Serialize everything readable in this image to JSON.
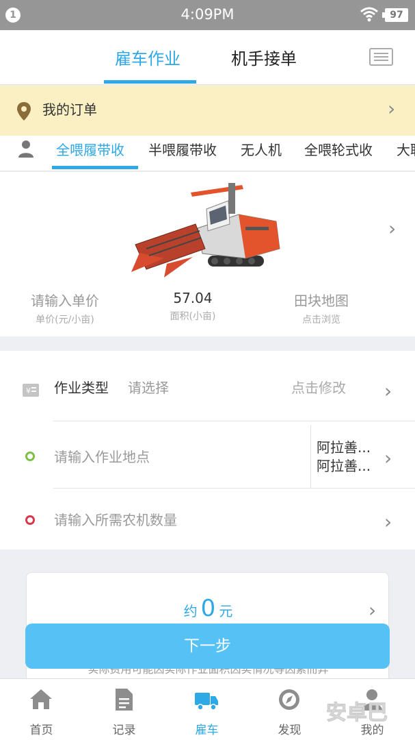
{
  "status_bar": {
    "notification_count": "1",
    "time": "4:09PM",
    "battery": "97"
  },
  "top_tabs": [
    {
      "label": "雇车作业",
      "active": true
    },
    {
      "label": "机手接单",
      "active": false
    }
  ],
  "order_banner": {
    "label": "我的订单"
  },
  "category_tabs": [
    {
      "label": "全喂履带收",
      "active": true
    },
    {
      "label": "半喂履带收",
      "active": false
    },
    {
      "label": "无人机",
      "active": false
    },
    {
      "label": "全喂轮式收",
      "active": false
    },
    {
      "label": "大联",
      "active": false
    }
  ],
  "machine": {
    "unit_price_placeholder": "请输入单价",
    "unit_price_sub": "单价(元/小亩)",
    "area_value": "57.04",
    "area_sub": "面积(小亩)",
    "map_label": "田块地图",
    "map_sub": "点击浏览"
  },
  "form": {
    "work_type_label": "作业类型",
    "work_type_placeholder": "请选择",
    "work_type_action": "点击修改",
    "location_placeholder": "请输入作业地点",
    "location_value_1": "阿拉善...",
    "location_value_2": "阿拉善...",
    "quantity_placeholder": "请输入所需农机数量"
  },
  "price": {
    "prefix": "约",
    "value": "0",
    "unit": "元",
    "note": "实际费用可能因实际作业面积因实情况等因素而异"
  },
  "next_button": "下一步",
  "bottom_nav": [
    {
      "label": "首页",
      "icon": "home-icon",
      "active": false
    },
    {
      "label": "记录",
      "icon": "document-icon",
      "active": false
    },
    {
      "label": "雇车",
      "icon": "truck-icon",
      "active": true
    },
    {
      "label": "发现",
      "icon": "compass-icon",
      "active": false
    },
    {
      "label": "我的",
      "icon": "person-icon",
      "active": false
    }
  ],
  "watermark": "安卓巴",
  "colors": {
    "accent": "#2fa8e6",
    "button": "#56c1f5",
    "banner": "#fbf0c4"
  }
}
